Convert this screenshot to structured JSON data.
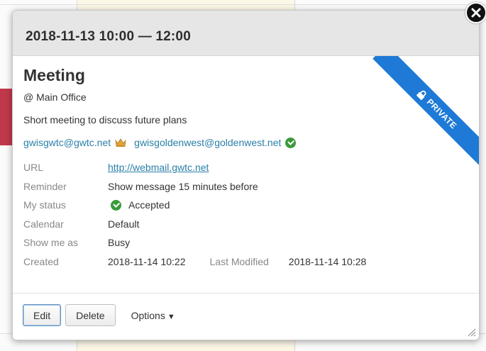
{
  "dialog": {
    "header_title": "2018-11-13 10:00 — 12:00",
    "ribbon_label": "PRIVATE",
    "event_title": "Meeting",
    "location": "@ Main Office",
    "description": "Short meeting to discuss future plans",
    "attendees": [
      {
        "email": "gwisgwtc@gwtc.net",
        "icon": "organizer-crown-icon"
      },
      {
        "email": "gwisgoldenwest@goldenwest.net",
        "icon": "accepted-check-icon"
      }
    ],
    "props": {
      "url_label": "URL",
      "url_value": "http://webmail.gwtc.net",
      "reminder_label": "Reminder",
      "reminder_value": "Show message 15 minutes before",
      "status_label": "My status",
      "status_value": "Accepted",
      "calendar_label": "Calendar",
      "calendar_value": "Default",
      "showas_label": "Show me as",
      "showas_value": "Busy",
      "created_label": "Created",
      "created_value": "2018-11-14 10:22",
      "modified_label": "Last Modified",
      "modified_value": "2018-11-14 10:28"
    },
    "footer": {
      "edit_label": "Edit",
      "delete_label": "Delete",
      "options_label": "Options"
    }
  },
  "colors": {
    "ribbon": "#1e7ad6",
    "link": "#2a7fa8",
    "calendar_default": "#b8303a",
    "accepted": "#3a9a3a"
  }
}
